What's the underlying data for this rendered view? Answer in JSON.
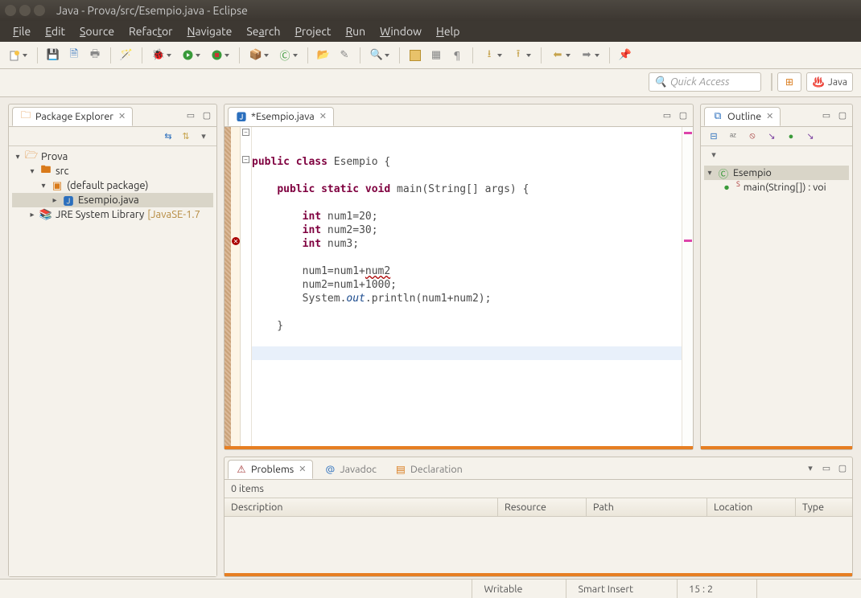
{
  "window": {
    "title": "Java - Prova/src/Esempio.java - Eclipse"
  },
  "menu": [
    "File",
    "Edit",
    "Source",
    "Refactor",
    "Navigate",
    "Search",
    "Project",
    "Run",
    "Window",
    "Help"
  ],
  "quick_access": {
    "placeholder": "Quick Access"
  },
  "perspective": {
    "java_label": "Java"
  },
  "package_explorer": {
    "title": "Package Explorer",
    "tree": {
      "project": "Prova",
      "src": "src",
      "pkg": "(default package)",
      "file": "Esempio.java",
      "jre": "JRE System Library",
      "jre_tag": "[JavaSE-1.7"
    }
  },
  "editor": {
    "tab_title": "*Esempio.java",
    "code_lines": [
      {
        "indent": 0,
        "tokens": [
          {
            "t": "public",
            "c": "kw"
          },
          {
            "t": " "
          },
          {
            "t": "class",
            "c": "kw"
          },
          {
            "t": " Esempio {"
          }
        ]
      },
      {
        "blank": true
      },
      {
        "indent": 1,
        "tokens": [
          {
            "t": "public",
            "c": "kw"
          },
          {
            "t": " "
          },
          {
            "t": "static",
            "c": "kw"
          },
          {
            "t": " "
          },
          {
            "t": "void",
            "c": "kw"
          },
          {
            "t": " main(String[] args) {"
          }
        ]
      },
      {
        "blank": true
      },
      {
        "indent": 2,
        "tokens": [
          {
            "t": "int",
            "c": "kw"
          },
          {
            "t": " num1=20;"
          }
        ]
      },
      {
        "indent": 2,
        "tokens": [
          {
            "t": "int",
            "c": "kw"
          },
          {
            "t": " num2=30;"
          }
        ]
      },
      {
        "indent": 2,
        "tokens": [
          {
            "t": "int",
            "c": "kw"
          },
          {
            "t": " num3;"
          }
        ]
      },
      {
        "blank": true
      },
      {
        "indent": 2,
        "tokens": [
          {
            "t": "num1=num1+"
          },
          {
            "t": "num2",
            "c": "uline"
          }
        ]
      },
      {
        "indent": 2,
        "tokens": [
          {
            "t": "num2=num1+1000;"
          }
        ]
      },
      {
        "indent": 2,
        "tokens": [
          {
            "t": "System."
          },
          {
            "t": "out",
            "c": "it"
          },
          {
            "t": ".println(num1+num2);"
          }
        ]
      },
      {
        "blank": true
      },
      {
        "indent": 1,
        "tokens": [
          {
            "t": "}"
          }
        ]
      },
      {
        "blank": true
      },
      {
        "indent": 0,
        "tokens": [
          {
            "t": "}"
          }
        ],
        "highlight": true
      }
    ]
  },
  "outline": {
    "title": "Outline",
    "class_name": "Esempio",
    "method": "main(String[]) : void",
    "method_display_prefix": "main(String[]) : voi"
  },
  "problems": {
    "tab_problems": "Problems",
    "tab_javadoc": "Javadoc",
    "tab_declaration": "Declaration",
    "items_label": "0 items",
    "columns": [
      "Description",
      "Resource",
      "Path",
      "Location",
      "Type"
    ]
  },
  "status": {
    "writable": "Writable",
    "insert": "Smart Insert",
    "pos": "15 : 2"
  }
}
